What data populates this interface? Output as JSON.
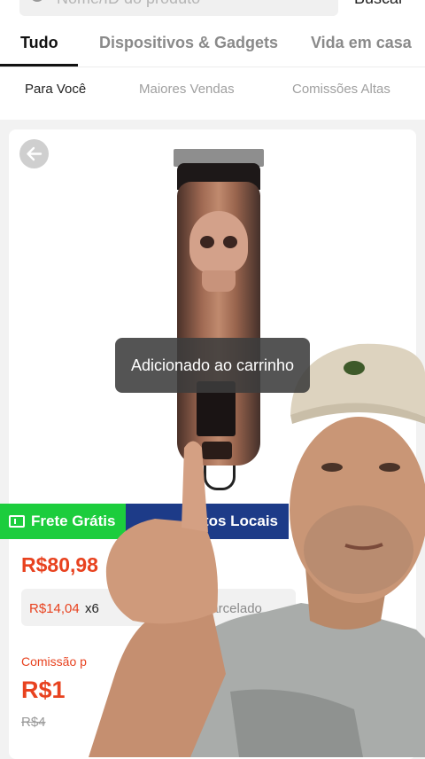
{
  "header": {
    "search_placeholder": "Nome/ID do produto",
    "search_button": "Buscar"
  },
  "tabs": [
    {
      "label": "Tudo"
    },
    {
      "label": "Dispositivos & Gadgets"
    },
    {
      "label": "Vida em casa"
    }
  ],
  "subtabs": [
    {
      "label": "Para Você"
    },
    {
      "label": "Maiores Vendas"
    },
    {
      "label": "Comissões Altas"
    }
  ],
  "product": {
    "toast": "Adicionado ao carrinho",
    "badge_shipping": "Frete Grátis",
    "badge_local": "utos Locais",
    "price": "R$80,98",
    "installment_value": "R$14,04",
    "installment_mult": "x6",
    "installment_suffix": "parcelado",
    "commission_label": "Comissão p",
    "commission_value": "R$1",
    "old_price": "R$4"
  },
  "colors": {
    "accent": "#e8421f",
    "green_badge": "#1ccd3d",
    "blue_badge": "#1d3b88"
  }
}
